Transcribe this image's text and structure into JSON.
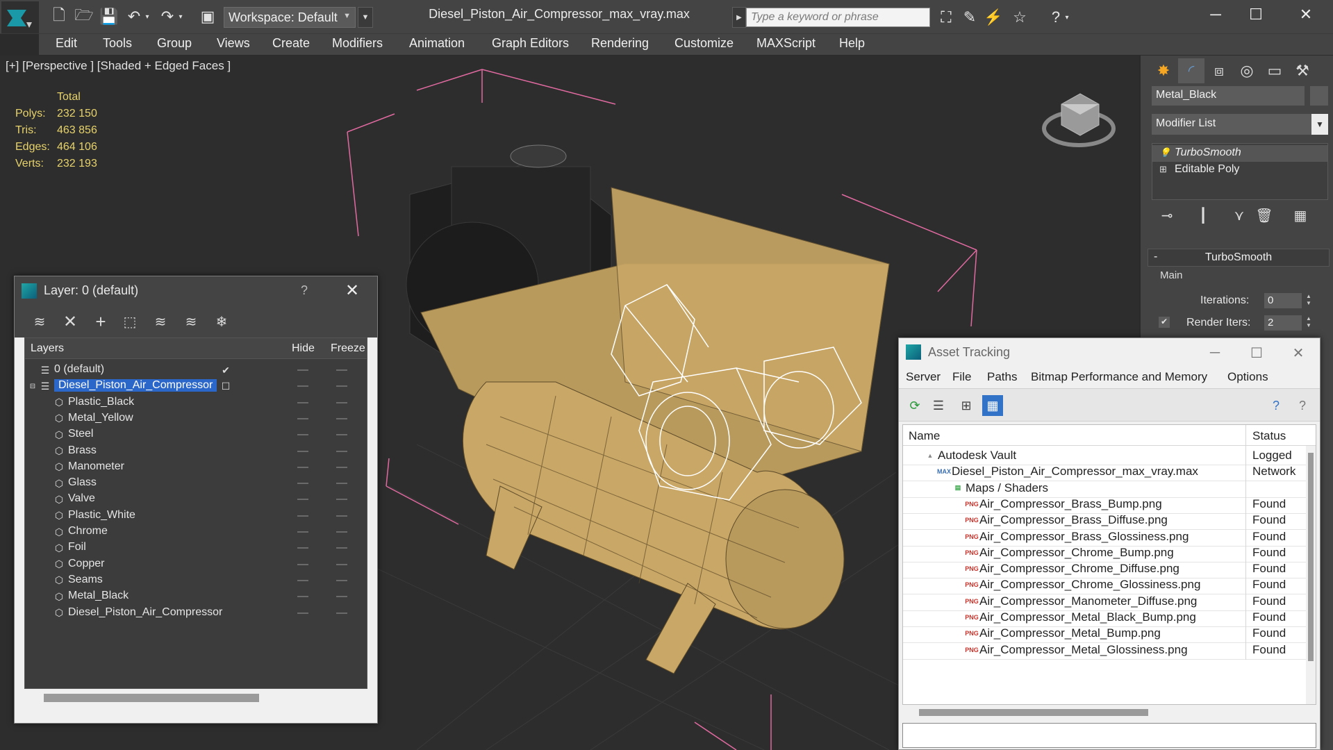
{
  "window": {
    "title": "Diesel_Piston_Air_Compressor_max_vray.max",
    "workspace": "Workspace: Default",
    "search_placeholder": "Type a keyword or phrase"
  },
  "menu": [
    "Edit",
    "Tools",
    "Group",
    "Views",
    "Create",
    "Modifiers",
    "Animation",
    "Graph Editors",
    "Rendering",
    "Customize",
    "MAXScript",
    "Help"
  ],
  "viewport": {
    "label": "[+] [Perspective ] [Shaded + Edged Faces ]",
    "stats": {
      "header": "Total",
      "rows": [
        {
          "label": "Polys:",
          "value": "232 150"
        },
        {
          "label": "Tris:",
          "value": "463 856"
        },
        {
          "label": "Edges:",
          "value": "464 106"
        },
        {
          "label": "Verts:",
          "value": "232 193"
        }
      ]
    }
  },
  "command_panel": {
    "object_name": "Metal_Black",
    "modifier_list": "Modifier List",
    "stack": [
      "TurboSmooth",
      "Editable Poly"
    ],
    "rollout": {
      "title": "TurboSmooth",
      "group": "Main",
      "iterations_label": "Iterations:",
      "iterations_value": "0",
      "render_iters_label": "Render Iters:",
      "render_iters_value": "2"
    }
  },
  "layer_dialog": {
    "title": "Layer: 0 (default)",
    "help": "?",
    "columns": {
      "layers": "Layers",
      "hide": "Hide",
      "freeze": "Freeze"
    },
    "rows": [
      {
        "name": "0 (default)",
        "level": 0,
        "kind": "layer"
      },
      {
        "name": "Diesel_Piston_Air_Compressor",
        "level": 0,
        "kind": "layer",
        "selected": true
      },
      {
        "name": "Plastic_Black",
        "level": 1,
        "kind": "object"
      },
      {
        "name": "Metal_Yellow",
        "level": 1,
        "kind": "object"
      },
      {
        "name": "Steel",
        "level": 1,
        "kind": "object"
      },
      {
        "name": "Brass",
        "level": 1,
        "kind": "object"
      },
      {
        "name": "Manometer",
        "level": 1,
        "kind": "object"
      },
      {
        "name": "Glass",
        "level": 1,
        "kind": "object"
      },
      {
        "name": "Valve",
        "level": 1,
        "kind": "object"
      },
      {
        "name": "Plastic_White",
        "level": 1,
        "kind": "object"
      },
      {
        "name": "Chrome",
        "level": 1,
        "kind": "object"
      },
      {
        "name": "Foil",
        "level": 1,
        "kind": "object"
      },
      {
        "name": "Copper",
        "level": 1,
        "kind": "object"
      },
      {
        "name": "Seams",
        "level": 1,
        "kind": "object"
      },
      {
        "name": "Metal_Black",
        "level": 1,
        "kind": "object"
      },
      {
        "name": "Diesel_Piston_Air_Compressor",
        "level": 1,
        "kind": "object"
      }
    ]
  },
  "asset_dialog": {
    "title": "Asset Tracking",
    "menu": [
      "Server",
      "File",
      "Paths",
      "Bitmap Performance and Memory",
      "Options"
    ],
    "columns": {
      "name": "Name",
      "status": "Status"
    },
    "rows": [
      {
        "name": "Autodesk Vault",
        "status": "Logged",
        "level": 0,
        "icon": "vault"
      },
      {
        "name": "Diesel_Piston_Air_Compressor_max_vray.max",
        "status": "Network",
        "level": 1,
        "icon": "max"
      },
      {
        "name": "Maps / Shaders",
        "status": "",
        "level": 2,
        "icon": "maps"
      },
      {
        "name": "Air_Compressor_Brass_Bump.png",
        "status": "Found",
        "level": 3,
        "icon": "png"
      },
      {
        "name": "Air_Compressor_Brass_Diffuse.png",
        "status": "Found",
        "level": 3,
        "icon": "png"
      },
      {
        "name": "Air_Compressor_Brass_Glossiness.png",
        "status": "Found",
        "level": 3,
        "icon": "png"
      },
      {
        "name": "Air_Compressor_Chrome_Bump.png",
        "status": "Found",
        "level": 3,
        "icon": "png"
      },
      {
        "name": "Air_Compressor_Chrome_Diffuse.png",
        "status": "Found",
        "level": 3,
        "icon": "png"
      },
      {
        "name": "Air_Compressor_Chrome_Glossiness.png",
        "status": "Found",
        "level": 3,
        "icon": "png"
      },
      {
        "name": "Air_Compressor_Manometer_Diffuse.png",
        "status": "Found",
        "level": 3,
        "icon": "png"
      },
      {
        "name": "Air_Compressor_Metal_Black_Bump.png",
        "status": "Found",
        "level": 3,
        "icon": "png"
      },
      {
        "name": "Air_Compressor_Metal_Bump.png",
        "status": "Found",
        "level": 3,
        "icon": "png"
      },
      {
        "name": "Air_Compressor_Metal_Glossiness.png",
        "status": "Found",
        "level": 3,
        "icon": "png"
      }
    ]
  },
  "colors": {
    "stats_text": "#e8d36a",
    "selection": "#2b66c9",
    "tank": "#c9a766",
    "bbox": "#e06aa0"
  }
}
